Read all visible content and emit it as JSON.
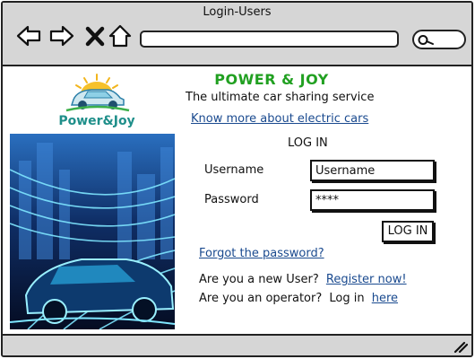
{
  "window": {
    "title": "Login-Users"
  },
  "toolbar": {
    "back_icon": "arrow-left-icon",
    "forward_icon": "arrow-right-icon",
    "stop_icon": "close-icon",
    "home_icon": "home-icon",
    "address_value": "",
    "search_icon": "search-icon"
  },
  "logo": {
    "text": "Power&Joy",
    "color": "#1f8f8a"
  },
  "header": {
    "brand": "POWER & JOY",
    "brand_color": "#21a021",
    "tagline": "The ultimate car sharing service",
    "know_more_link": "Know more about electric cars"
  },
  "login": {
    "heading": "LOG IN",
    "username_label": "Username",
    "username_value": "Username",
    "password_label": "Password",
    "password_value": "****",
    "submit_label": "LOG IN",
    "forgot_link": "Forgot the password?",
    "new_user_text": "Are you a new User?",
    "register_link": "Register now!",
    "operator_text": "Are you an operator?",
    "operator_login_text": "Log in",
    "operator_link": "here",
    "link_color": "#1a4a8f"
  }
}
